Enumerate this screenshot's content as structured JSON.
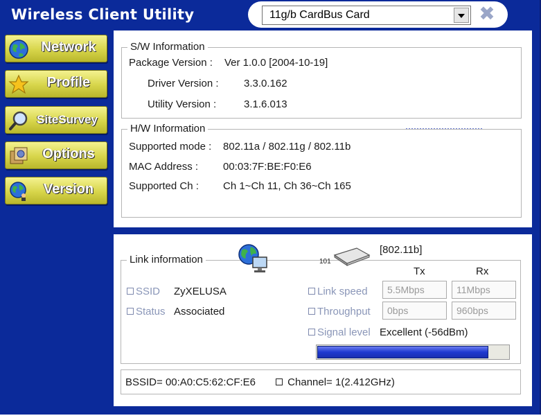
{
  "title": "Wireless Client Utility",
  "adapter_select": {
    "value": "11g/b CardBus Card"
  },
  "nav": [
    {
      "label": "Network",
      "icon": "globe-icon"
    },
    {
      "label": "Profile",
      "icon": "star-icon"
    },
    {
      "label": "SiteSurvey",
      "icon": "magnifier-icon"
    },
    {
      "label": "Options",
      "icon": "options-icon"
    },
    {
      "label": "Version",
      "icon": "globe-person-icon"
    }
  ],
  "sw_info": {
    "legend": "S/W Information",
    "package_label": "Package Version :",
    "package_value": "Ver 1.0.0 [2004-10-19]",
    "driver_label": "Driver Version :",
    "driver_value": "3.3.0.162",
    "utility_label": "Utility Version :",
    "utility_value": "3.1.6.013"
  },
  "hw_info": {
    "legend": "H/W Information",
    "mode_label": "Supported mode :",
    "mode_value": "802.11a / 802.11g / 802.11b",
    "mac_label": "MAC Address :",
    "mac_value": "00:03:7F:BE:F0:E6",
    "ch_label": "Supported Ch :",
    "ch_value": "Ch 1~Ch 11, Ch 36~Ch 165"
  },
  "link": {
    "legend": "Link information",
    "standard": "[802.11b]",
    "device_number": "101",
    "tx_header": "Tx",
    "rx_header": "Rx",
    "ssid_label": "SSID",
    "ssid_value": "ZyXELUSA",
    "status_label": "Status",
    "status_value": "Associated",
    "link_speed_label": "Link speed",
    "link_speed_tx": "5.5Mbps",
    "link_speed_rx": "11Mbps",
    "throughput_label": "Throughput",
    "throughput_tx": "0bps",
    "throughput_rx": "960bps",
    "signal_label": "Signal level",
    "signal_value": "Excellent (-56dBm)",
    "signal_fraction": 0.89
  },
  "status_bar": {
    "bssid": "BSSID= 00:A0:C5:62:CF:E6",
    "channel": "Channel= 1(2.412GHz)"
  },
  "colors": {
    "background": "#0b2a9a",
    "nav_button": "#d7d54a",
    "signal_fill": "#1f3ad0"
  }
}
